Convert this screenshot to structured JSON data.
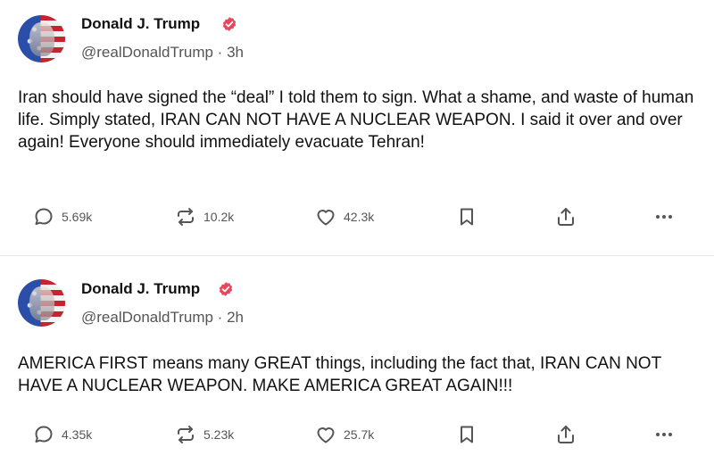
{
  "posts": [
    {
      "author_name": "Donald J. Trump",
      "handle_line": "@realDonaldTrump · 3h",
      "text": "Iran should have signed the “deal” I told them to sign. What a shame, and waste of human life. Simply stated, IRAN CAN NOT HAVE A NUCLEAR WEAPON. I said it over and over again! Everyone should immediately evacuate Tehran!",
      "replies": "5.69k",
      "reposts": "10.2k",
      "likes": "42.3k"
    },
    {
      "author_name": "Donald J. Trump",
      "handle_line": "@realDonaldTrump · 2h",
      "text": "AMERICA FIRST means many GREAT things, including the fact that, IRAN CAN NOT HAVE A NUCLEAR WEAPON. MAKE AMERICA GREAT AGAIN!!!",
      "replies": "4.35k",
      "reposts": "5.23k",
      "likes": "25.7k"
    }
  ],
  "icons": {
    "reply": "reply-icon",
    "repost": "repost-icon",
    "like": "heart-icon",
    "bookmark": "bookmark-icon",
    "share": "share-icon",
    "more": "more-icon",
    "verified": "verified-badge-icon"
  },
  "colors": {
    "verified_badge": "#e8465b",
    "text": "#111111",
    "muted": "#555555",
    "icon": "#555555"
  }
}
